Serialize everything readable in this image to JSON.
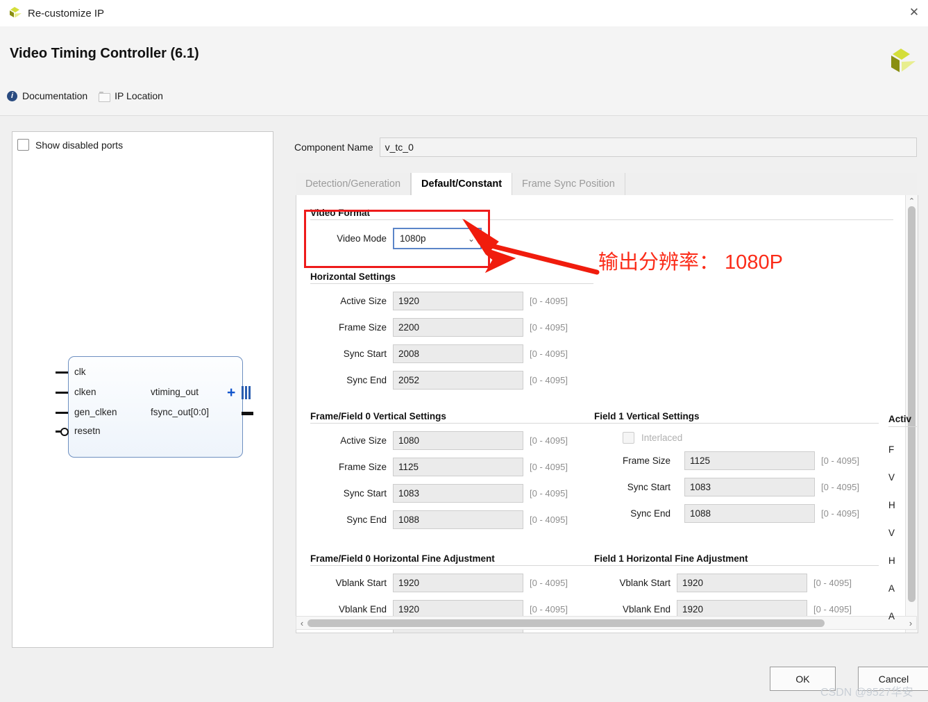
{
  "window": {
    "title": "Re-customize IP",
    "close_label": "✕",
    "logo_name": "xilinx-logo"
  },
  "header": {
    "app_title": "Video Timing Controller (6.1)",
    "links": [
      {
        "label": "Documentation",
        "icon": "info-icon"
      },
      {
        "label": "IP Location",
        "icon": "folder-icon"
      }
    ]
  },
  "ports_panel": {
    "show_disabled_label": "Show disabled ports",
    "show_disabled_checked": false,
    "block": {
      "inputs": [
        "clk",
        "clken",
        "gen_clken",
        "resetn"
      ],
      "outputs": [
        "vtiming_out",
        "fsync_out[0:0]"
      ]
    }
  },
  "component": {
    "name_label": "Component Name",
    "name_value": "v_tc_0"
  },
  "tabs": [
    {
      "label": "Detection/Generation",
      "active": false
    },
    {
      "label": "Default/Constant",
      "active": true
    },
    {
      "label": "Frame Sync Position",
      "active": false
    }
  ],
  "video_format": {
    "title": "Video Format",
    "mode_label": "Video Mode",
    "mode_value": "1080p",
    "caret": "⌄"
  },
  "horizontal_settings": {
    "title": "Horizontal Settings",
    "rows": [
      {
        "label": "Active Size",
        "value": "1920",
        "range": "[0 - 4095]"
      },
      {
        "label": "Frame Size",
        "value": "2200",
        "range": "[0 - 4095]"
      },
      {
        "label": "Sync Start",
        "value": "2008",
        "range": "[0 - 4095]"
      },
      {
        "label": "Sync End",
        "value": "2052",
        "range": "[0 - 4095]"
      }
    ]
  },
  "frame_field0_vertical": {
    "title": "Frame/Field 0 Vertical Settings",
    "rows": [
      {
        "label": "Active Size",
        "value": "1080",
        "range": "[0 - 4095]"
      },
      {
        "label": "Frame Size",
        "value": "1125",
        "range": "[0 - 4095]"
      },
      {
        "label": "Sync Start",
        "value": "1083",
        "range": "[0 - 4095]"
      },
      {
        "label": "Sync End",
        "value": "1088",
        "range": "[0 - 4095]"
      }
    ]
  },
  "field1_vertical": {
    "title": "Field 1 Vertical Settings",
    "interlaced_label": "Interlaced",
    "interlaced_checked": false,
    "rows": [
      {
        "label": "Frame Size",
        "value": "1125",
        "range": "[0 - 4095]"
      },
      {
        "label": "Sync Start",
        "value": "1083",
        "range": "[0 - 4095]"
      },
      {
        "label": "Sync End",
        "value": "1088",
        "range": "[0 - 4095]"
      }
    ]
  },
  "frame_field0_hfine": {
    "title": "Frame/Field 0 Horizontal Fine Adjustment",
    "rows": [
      {
        "label": "Vblank Start",
        "value": "1920",
        "range": "[0 - 4095]"
      },
      {
        "label": "Vblank End",
        "value": "1920",
        "range": "[0 - 4095]"
      }
    ]
  },
  "field1_hfine": {
    "title": "Field 1 Horizontal Fine Adjustment",
    "rows": [
      {
        "label": "Vblank Start",
        "value": "1920",
        "range": "[0 - 4095]"
      },
      {
        "label": "Vblank End",
        "value": "1920",
        "range": "[0 - 4095]"
      }
    ]
  },
  "clipped_column": {
    "title": "Activ",
    "items": [
      "F",
      "V",
      "H",
      "V",
      "H",
      "A",
      "A"
    ]
  },
  "annotation": {
    "text": "输出分辨率： 1080P",
    "color": "#fb2b18",
    "box_color": "#ee1b1b"
  },
  "buttons": {
    "ok": "OK",
    "cancel": "Cancel"
  },
  "watermark": "CSDN @9527华安",
  "scrollbars": {
    "v_up": "⌃",
    "v_down": "⌄",
    "h_left": "‹",
    "h_right": "›"
  }
}
